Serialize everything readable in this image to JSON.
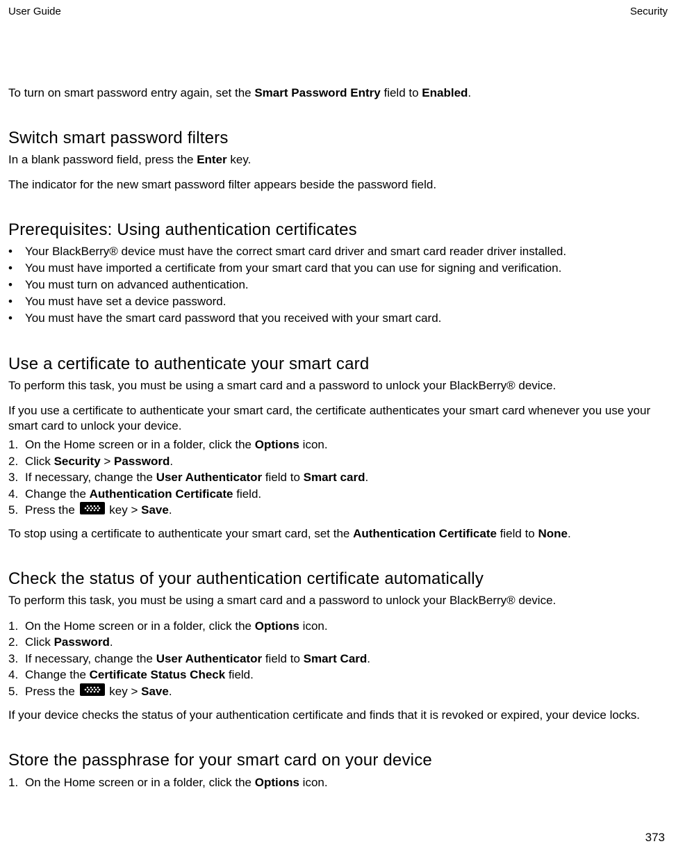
{
  "header": {
    "left": "User Guide",
    "right": "Security"
  },
  "intro": {
    "t1": "To turn on smart password entry again, set the ",
    "b1": "Smart Password Entry",
    "t2": " field to ",
    "b2": "Enabled",
    "t3": "."
  },
  "s1": {
    "heading": "Switch smart password filters",
    "p1a": "In a blank password field, press the ",
    "p1b": "Enter",
    "p1c": " key.",
    "p2": "The indicator for the new smart password filter appears beside the password field."
  },
  "s2": {
    "heading": "Prerequisites: Using authentication certificates",
    "items": [
      "Your BlackBerry® device must have the correct smart card driver and smart card reader driver installed.",
      "You must have imported a certificate from your smart card that you can use for signing and verification.",
      "You must turn on advanced authentication.",
      "You must have set a device password.",
      "You must have the smart card password that you received with your smart card."
    ]
  },
  "s3": {
    "heading": "Use a certificate to authenticate your smart card",
    "p1": "To perform this task, you must be using a smart card and a password to unlock your BlackBerry® device.",
    "p2": "If you use a certificate to authenticate your smart card, the certificate authenticates your smart card whenever you use your smart card to unlock your device.",
    "step1a": "On the Home screen or in a folder, click the ",
    "step1b": "Options",
    "step1c": " icon.",
    "step2a": "Click ",
    "step2b": "Security",
    "step2c": " > ",
    "step2d": "Password",
    "step2e": ".",
    "step3a": "If necessary, change the ",
    "step3b": "User Authenticator",
    "step3c": " field to ",
    "step3d": "Smart card",
    "step3e": ".",
    "step4a": "Change the ",
    "step4b": "Authentication Certificate",
    "step4c": " field.",
    "step5a": "Press the ",
    "step5b": " key > ",
    "step5c": "Save",
    "step5d": ".",
    "outroA": "To stop using a certificate to authenticate your smart card, set the ",
    "outroB": "Authentication Certificate",
    "outroC": " field to ",
    "outroD": "None",
    "outroE": "."
  },
  "s4": {
    "heading": "Check the status of your authentication certificate automatically",
    "p1": "To perform this task, you must be using a smart card and a password to unlock your BlackBerry® device.",
    "step1a": "On the Home screen or in a folder, click the ",
    "step1b": "Options",
    "step1c": " icon.",
    "step2a": "Click ",
    "step2b": "Password",
    "step2c": ".",
    "step3a": "If necessary, change the ",
    "step3b": "User Authenticator",
    "step3c": " field to ",
    "step3d": "Smart Card",
    "step3e": ".",
    "step4a": "Change the ",
    "step4b": "Certificate Status Check",
    "step4c": " field.",
    "step5a": "Press the ",
    "step5b": " key > ",
    "step5c": "Save",
    "step5d": ".",
    "outro": "If your device checks the status of your authentication certificate and finds that it is revoked or expired, your device locks."
  },
  "s5": {
    "heading": "Store the passphrase for your smart card on your device",
    "step1a": "On the Home screen or in a folder, click the ",
    "step1b": "Options",
    "step1c": " icon."
  },
  "pageNumber": "373"
}
